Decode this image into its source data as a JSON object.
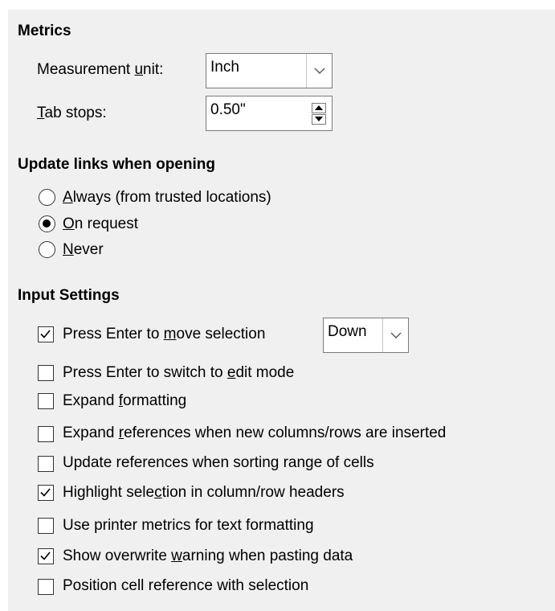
{
  "metrics": {
    "heading": "Metrics",
    "measurement_unit": {
      "label_pre": "Measurement ",
      "label_ul": "u",
      "label_post": "nit:",
      "value": "Inch"
    },
    "tab_stops": {
      "label_ul": "T",
      "label_post": "ab stops:",
      "value": "0.50\""
    }
  },
  "update_links": {
    "heading": "Update links when opening",
    "options": [
      {
        "ul": "A",
        "rest": "lways (from trusted locations)",
        "selected": false
      },
      {
        "ul": "O",
        "rest": "n request",
        "selected": true
      },
      {
        "ul": "N",
        "rest": "ever",
        "selected": false
      }
    ]
  },
  "input_settings": {
    "heading": "Input Settings",
    "move_direction": "Down",
    "items": [
      {
        "pre": "Press Enter to ",
        "ul": "m",
        "post": "ove selection",
        "checked": true
      },
      {
        "pre": "Press Enter to switch to ",
        "ul": "e",
        "post": "dit mode",
        "checked": false
      },
      {
        "pre": "Expand ",
        "ul": "f",
        "post": "ormatting",
        "checked": false
      },
      {
        "pre": "Expand ",
        "ul": "r",
        "post": "eferences when new columns/rows are inserted",
        "checked": false
      },
      {
        "pre": "Update references when sorting range of cells",
        "ul": "",
        "post": "",
        "checked": false
      },
      {
        "pre": "Highlight sele",
        "ul": "c",
        "post": "tion in column/row headers",
        "checked": true
      },
      {
        "pre": "Use printer metrics for text formatting",
        "ul": "",
        "post": "",
        "checked": false
      },
      {
        "pre": "Show overwrite ",
        "ul": "w",
        "post": "arning when pasting data",
        "checked": true
      },
      {
        "pre": "Position cell reference with selection",
        "ul": "",
        "post": "",
        "checked": false
      }
    ]
  },
  "icons": {
    "dropdown": "chevron-down-icon",
    "spin_up": "triangle-up-icon",
    "spin_down": "triangle-down-icon",
    "check": "checkmark-icon"
  }
}
